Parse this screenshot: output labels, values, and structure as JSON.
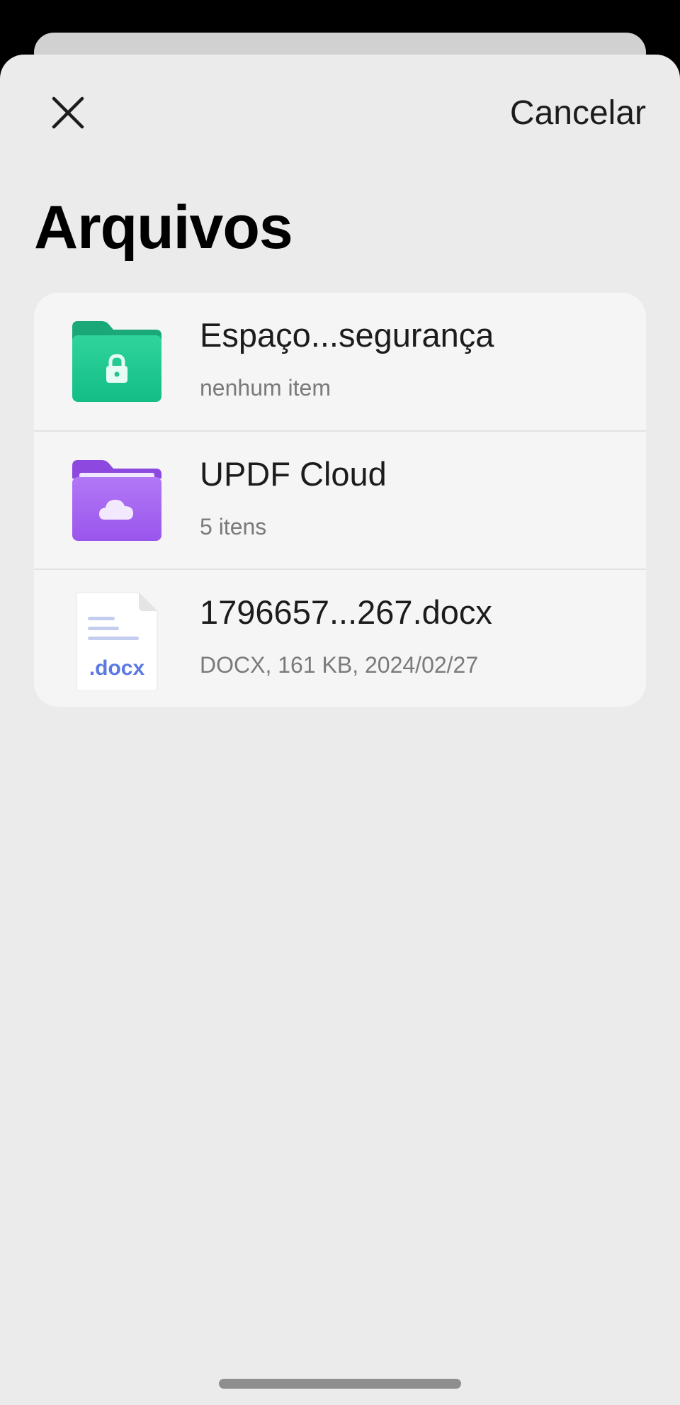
{
  "header": {
    "cancel_label": "Cancelar",
    "close_icon": "close-icon"
  },
  "page": {
    "title": "Arquivos"
  },
  "items": [
    {
      "title": "Espaço...segurança",
      "subtitle": "nenhum item",
      "icon": "secure-folder-icon",
      "color": "#22c48f"
    },
    {
      "title": "UPDF Cloud",
      "subtitle": "5 itens",
      "icon": "cloud-folder-icon",
      "color": "#a25ff0"
    },
    {
      "title": "1796657...267.docx",
      "subtitle": "DOCX, 161 KB, 2024/02/27",
      "icon": "docx-file-icon",
      "badge": ".docx",
      "color": "#5b79e0"
    }
  ]
}
